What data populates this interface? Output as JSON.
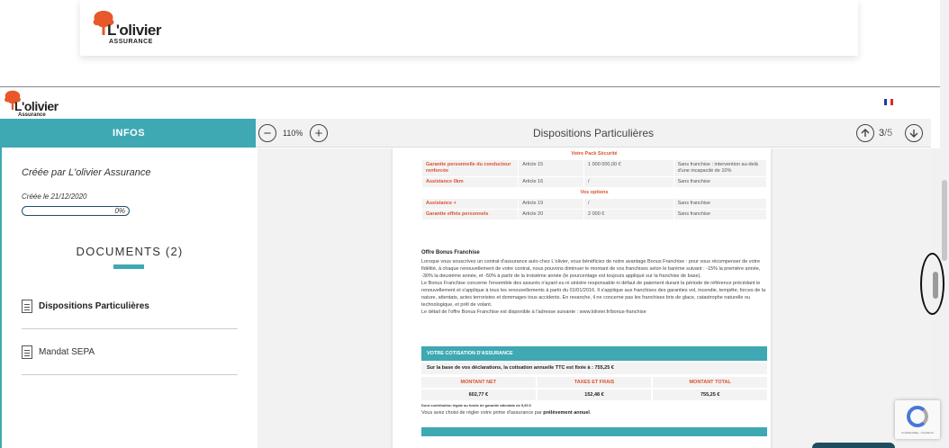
{
  "colors": {
    "accent": "#3ea8b3",
    "orange": "#e8582a",
    "red_text": "#d9532f",
    "dark_blue": "#1f4e6b"
  },
  "site_header": {
    "brand": "L'olivier",
    "sub": "ASSURANCE",
    "logo_icon": "olive-tree-icon"
  },
  "viewer_header": {
    "brand": "L'olivier",
    "sub": "Assurance",
    "flag_icon": "french-flag-icon"
  },
  "sidebar": {
    "tab_label": "INFOS",
    "created_by": "Créée par L'olivier Assurance",
    "created_on": "Créée le 21/12/2020",
    "progress_percent": 0,
    "progress_label": "0%",
    "documents_title": "DOCUMENTS (2)",
    "documents": [
      {
        "label": "Dispositions Particulières",
        "active": true,
        "icon": "document-icon"
      },
      {
        "label": "Mandat SEPA",
        "active": false,
        "icon": "document-icon"
      }
    ]
  },
  "toolbar": {
    "zoom_out_icon": "minus-circle-icon",
    "zoom_out_glyph": "−",
    "zoom_level": "110%",
    "zoom_in_icon": "plus-circle-icon",
    "zoom_in_glyph": "+",
    "document_title": "Dispositions Particulières",
    "prev_icon": "arrow-up-circle-icon",
    "current_page": "3",
    "total_pages": "/5",
    "next_icon": "arrow-down-circle-icon"
  },
  "document": {
    "pack_heading": "Votre Pack Sécurité",
    "pack_rows": [
      {
        "name": "Garantie personnelle du conducteur renforcée",
        "article": "Article 15",
        "amount": "1 000 000,00 €",
        "franchise": "Sans franchise : intervention au-delà d'une incapacité de 10%"
      },
      {
        "name": "Assistance 0km",
        "article": "Article 16",
        "amount": "/",
        "franchise": "Sans franchise"
      }
    ],
    "options_heading": "Vos options",
    "option_rows": [
      {
        "name": "Assistance +",
        "article": "Article 19",
        "amount": "/",
        "franchise": "Sans franchise"
      },
      {
        "name": "Garantie effets personnels",
        "article": "Article 20",
        "amount": "2 000 €",
        "franchise": "Sans franchise"
      }
    ],
    "bonus_title": "Offre Bonus Franchise",
    "bonus_p1": "Lorsque vous souscrivez un contrat d'assurance auto chez L'olivier, vous bénéficiez de notre avantage Bonus Franchise : pour vous récompenser de votre fidélité, à chaque renouvellement de votre contrat, nous pouvons diminuer le montant de vos franchises selon le barème suivant : -15% la première année, -30% la deuxième année, et -50% à partir de la troisième année (le pourcentage est toujours appliqué sur la franchise de base).",
    "bonus_p2": "Le Bonus Franchise concerne l'ensemble des assurés n'ayant eu ni sinistre responsable ni défaut de paiement durant la période de référence précédant le renouvellement et s'applique à tous les renouvellements à partir du 01/01/2016. Il s'applique aux franchises des garanties vol, incendie, tempête, forces de la nature, attentats, actes terroristes et dommages tous accidents. En revanche, il ne concerne pas les franchises bris de glace, catastrophe naturelle ou technologique, et prêt de volant.",
    "bonus_p3": "Le détail de l'offre Bonus Franchise est disponible à l'adresse suivante : www.lolivier.fr/bonus-franchise",
    "cotisation_title": "VOTRE COTISATION D'ASSURANCE",
    "cotisation_line": "Sur la base de vos déclarations, la cotisation annuelle TTC est fixée à : 755,25 €",
    "amount_header_net": "MONTANT NET",
    "amount_header_taxes": "TAXES ET FRAIS",
    "amount_header_total": "MONTANT TOTAL",
    "amount_net": "602,77 €",
    "amount_taxes": "152,48 €",
    "amount_total": "755,25 €",
    "contribution_note": "Dont contribution légale au fonds de garantie attentats de 5,90 €",
    "payment_prefix": "Vous avez choisi de régler votre prime d'assurance par ",
    "payment_method": "prélèvement annuel",
    "payment_suffix": "."
  },
  "recaptcha": {
    "text": "Confidentialité - Conditions",
    "icon": "recaptcha-icon"
  }
}
